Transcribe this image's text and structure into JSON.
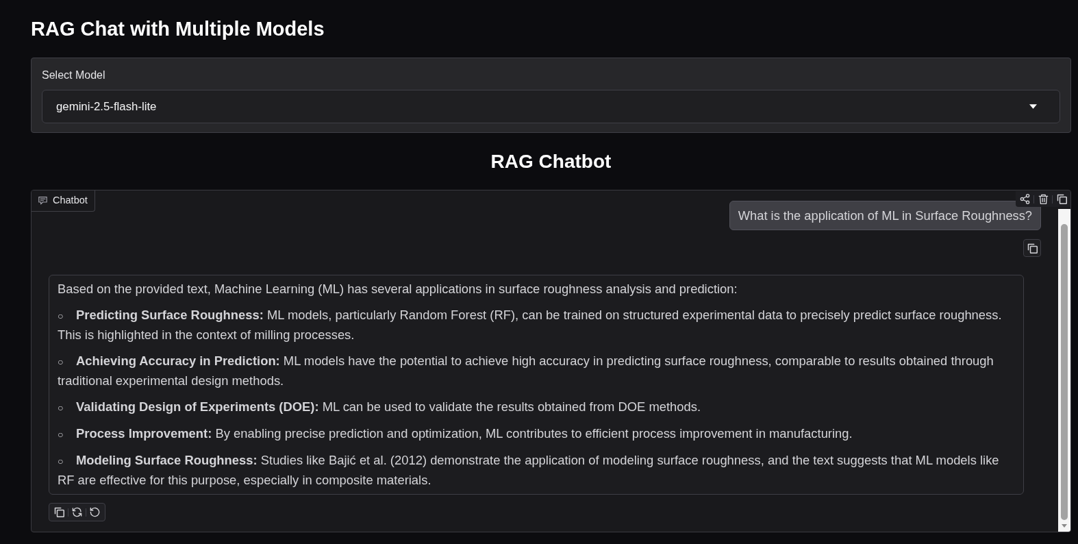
{
  "header": {
    "title": "RAG Chat with Multiple Models"
  },
  "model_select": {
    "label": "Select Model",
    "value": "gemini-2.5-flash-lite"
  },
  "chat_section": {
    "title": "RAG Chatbot"
  },
  "chatbot": {
    "label": "Chatbot",
    "messages": [
      {
        "kind": "user",
        "text": "What is the application of ML in Surface Roughness?"
      },
      {
        "kind": "bot",
        "intro": "Based on the provided text, Machine Learning (ML) has several applications in surface roughness analysis and prediction:",
        "items": [
          {
            "bullet": "○",
            "text": "**Predicting Surface Roughness:** ML models, particularly Random Forest (RF), can be trained on structured experimental data to precisely predict surface roughness. This is highlighted in the context of milling processes."
          },
          {
            "bullet": "○",
            "text": "**Achieving Accuracy in Prediction:** ML models have the potential to achieve high accuracy in predicting surface roughness, comparable to results obtained through traditional experimental design methods."
          },
          {
            "bullet": "○",
            "text": "**Validating Design of Experiments (DOE):** ML can be used to validate the results obtained from DOE methods."
          },
          {
            "bullet": "○",
            "text": "**Process Improvement:** By enabling precise prediction and optimization, ML contributes to efficient process improvement in manufacturing."
          },
          {
            "bullet": "○",
            "text": "**Modeling Surface Roughness:** Studies like Bajić et al. (2012) demonstrate the application of modeling surface roughness, and the text suggests that ML models like RF are effective for this purpose, especially in composite materials."
          }
        ]
      }
    ]
  }
}
